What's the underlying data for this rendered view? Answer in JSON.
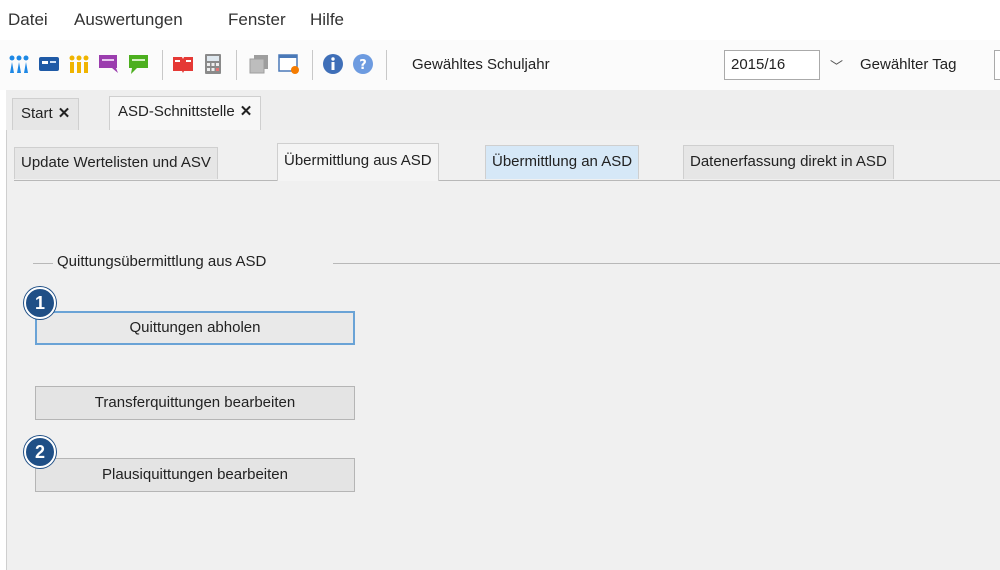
{
  "menu": [
    "Datei",
    "Auswertungen",
    "Fenster",
    "Hilfe"
  ],
  "toolbar": {
    "icons": [
      "people-blue-icon",
      "card-icon",
      "people-yellow-icon",
      "chat-purple-icon",
      "chat-green-icon",
      "book-red-icon",
      "calculator-icon",
      "copy-icon",
      "window-icon",
      "info-icon",
      "help-icon"
    ],
    "school_year_label": "Gewähltes Schuljahr",
    "school_year_value": "2015/16",
    "day_label": "Gewählter Tag"
  },
  "outer_tabs": [
    {
      "label": "Start",
      "close": "✕"
    },
    {
      "label": "ASD-Schnittstelle",
      "close": "✕"
    }
  ],
  "inner_tabs": [
    "Update Wertelisten und ASV",
    "Übermittlung aus ASD",
    "Übermittlung an ASD",
    "Datenerfassung direkt in ASD"
  ],
  "group": {
    "title": "Quittungsübermittlung aus ASD",
    "buttons": [
      "Quittungen abholen",
      "Transferquittungen bearbeiten",
      "Plausiquittungen bearbeiten"
    ]
  },
  "badges": [
    "1",
    "2"
  ]
}
